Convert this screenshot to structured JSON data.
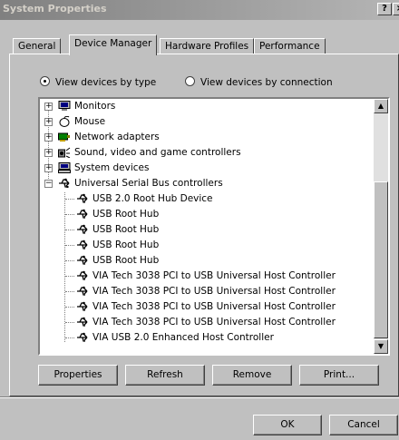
{
  "window": {
    "title": "System Properties",
    "help_label": "?",
    "close_label": "×"
  },
  "tabs": [
    {
      "label": "General"
    },
    {
      "label": "Device Manager",
      "active": true
    },
    {
      "label": "Hardware Profiles"
    },
    {
      "label": "Performance"
    }
  ],
  "view": {
    "by_type_label": "View devices by type",
    "by_connection_label": "View devices by connection",
    "selected": "by_type"
  },
  "tree": {
    "categories": [
      {
        "label": "Monitors",
        "icon": "monitor-icon"
      },
      {
        "label": "Mouse",
        "icon": "mouse-icon"
      },
      {
        "label": "Network adapters",
        "icon": "network-adapter-icon"
      },
      {
        "label": "Sound, video and game controllers",
        "icon": "sound-icon"
      },
      {
        "label": "System devices",
        "icon": "system-device-icon"
      },
      {
        "label": "Universal Serial Bus controllers",
        "icon": "usb-icon",
        "expanded": true
      }
    ],
    "usb_devices": [
      "USB 2.0 Root Hub Device",
      "USB Root Hub",
      "USB Root Hub",
      "USB Root Hub",
      "USB Root Hub",
      "VIA Tech 3038 PCI to USB Universal Host Controller",
      "VIA Tech 3038 PCI to USB Universal Host Controller",
      "VIA Tech 3038 PCI to USB Universal Host Controller",
      "VIA Tech 3038 PCI to USB Universal Host Controller",
      "VIA USB 2.0 Enhanced Host Controller"
    ]
  },
  "buttons": {
    "properties": "Properties",
    "refresh": "Refresh",
    "remove": "Remove",
    "print": "Print...",
    "ok": "OK",
    "cancel": "Cancel"
  }
}
